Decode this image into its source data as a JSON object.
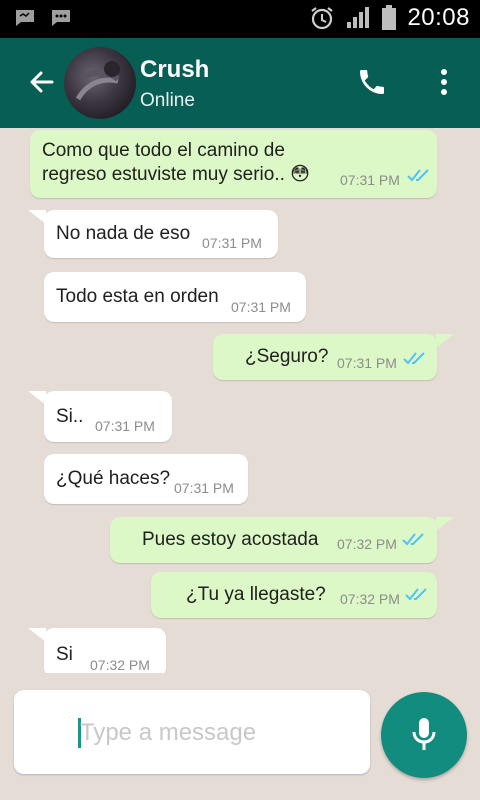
{
  "status_bar": {
    "time": "20:08",
    "left_icons": [
      "chat-notification-icon",
      "sms-notification-icon"
    ],
    "right_icons": [
      "alarm-icon",
      "signal-icon",
      "battery-icon"
    ]
  },
  "header": {
    "contact_name": "Crush",
    "contact_status": "Online",
    "icons": [
      "back-arrow-icon",
      "phone-icon",
      "more-vert-icon"
    ]
  },
  "messages": [
    {
      "direction": "out",
      "lines": [
        "Como que todo el camino de",
        "regreso estuviste muy serio.. 😳"
      ],
      "time": "07:31 PM",
      "read": true
    },
    {
      "direction": "in",
      "text": "No nada de eso",
      "time": "07:31 PM"
    },
    {
      "direction": "in",
      "text": "Todo esta en orden",
      "time": "07:31 PM"
    },
    {
      "direction": "out",
      "text": "¿Seguro?",
      "time": "07:31 PM",
      "read": true
    },
    {
      "direction": "in",
      "text": "Si..",
      "time": "07:31 PM"
    },
    {
      "direction": "in",
      "text": "¿Qué haces?",
      "time": "07:31 PM"
    },
    {
      "direction": "out",
      "text": "Pues estoy acostada",
      "time": "07:32 PM",
      "read": true
    },
    {
      "direction": "out",
      "text": "¿Tu ya llegaste?",
      "time": "07:32 PM",
      "read": true
    },
    {
      "direction": "in",
      "text": "Si",
      "time": "07:32 PM"
    }
  ],
  "composer": {
    "placeholder": "Type a message",
    "value": "",
    "mic_icon": "microphone-icon"
  },
  "colors": {
    "header": "#075e54",
    "outgoing_bubble": "#dcf8c6",
    "incoming_bubble": "#ffffff",
    "chat_background": "#e5ddd5",
    "read_ticks": "#4fc3f7",
    "fab": "#128c7e"
  }
}
